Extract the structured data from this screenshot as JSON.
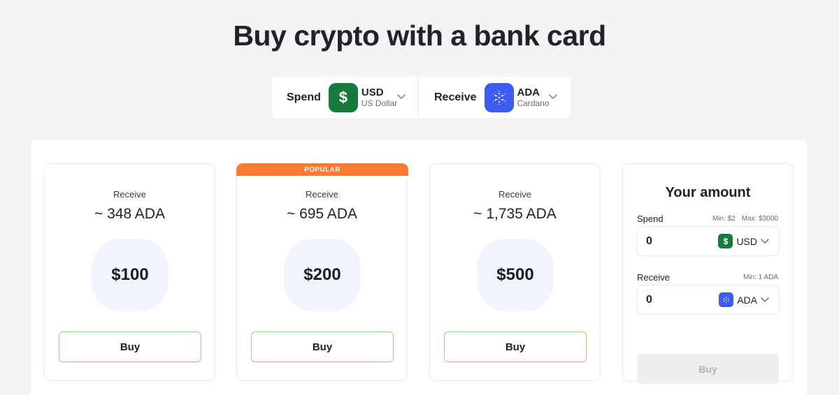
{
  "page_title": "Buy crypto with a bank card",
  "selector": {
    "spend": {
      "label": "Spend",
      "coin_glyph": "$",
      "code": "USD",
      "name": "US Dollar",
      "icon": "usd-coin-icon"
    },
    "receive": {
      "label": "Receive",
      "coin_glyph": "✺",
      "code": "ADA",
      "name": "Cardano",
      "icon": "cardano-coin-icon"
    }
  },
  "offers": [
    {
      "badge": "",
      "receive_label": "Receive",
      "receive_amount": "~ 348 ADA",
      "price": "$100",
      "button": "Buy"
    },
    {
      "badge": "POPULAR",
      "receive_label": "Receive",
      "receive_amount": "~ 695 ADA",
      "price": "$200",
      "button": "Buy"
    },
    {
      "badge": "",
      "receive_label": "Receive",
      "receive_amount": "~ 1,735 ADA",
      "price": "$500",
      "button": "Buy"
    }
  ],
  "amount_form": {
    "title": "Your amount",
    "spend": {
      "label": "Spend",
      "min": "Min: $2",
      "max": "Max: $3000",
      "value": "0",
      "currency_glyph": "$",
      "currency": "USD"
    },
    "receive": {
      "label": "Receive",
      "min": "Min: 1 ADA",
      "value": "0",
      "currency_glyph": "✺",
      "currency": "ADA"
    },
    "button": "Buy"
  },
  "colors": {
    "usd_green": "#157a3c",
    "ada_blue": "#3c5bf0",
    "popular_orange": "#ff7a32",
    "buy_border": "#f3a877"
  }
}
